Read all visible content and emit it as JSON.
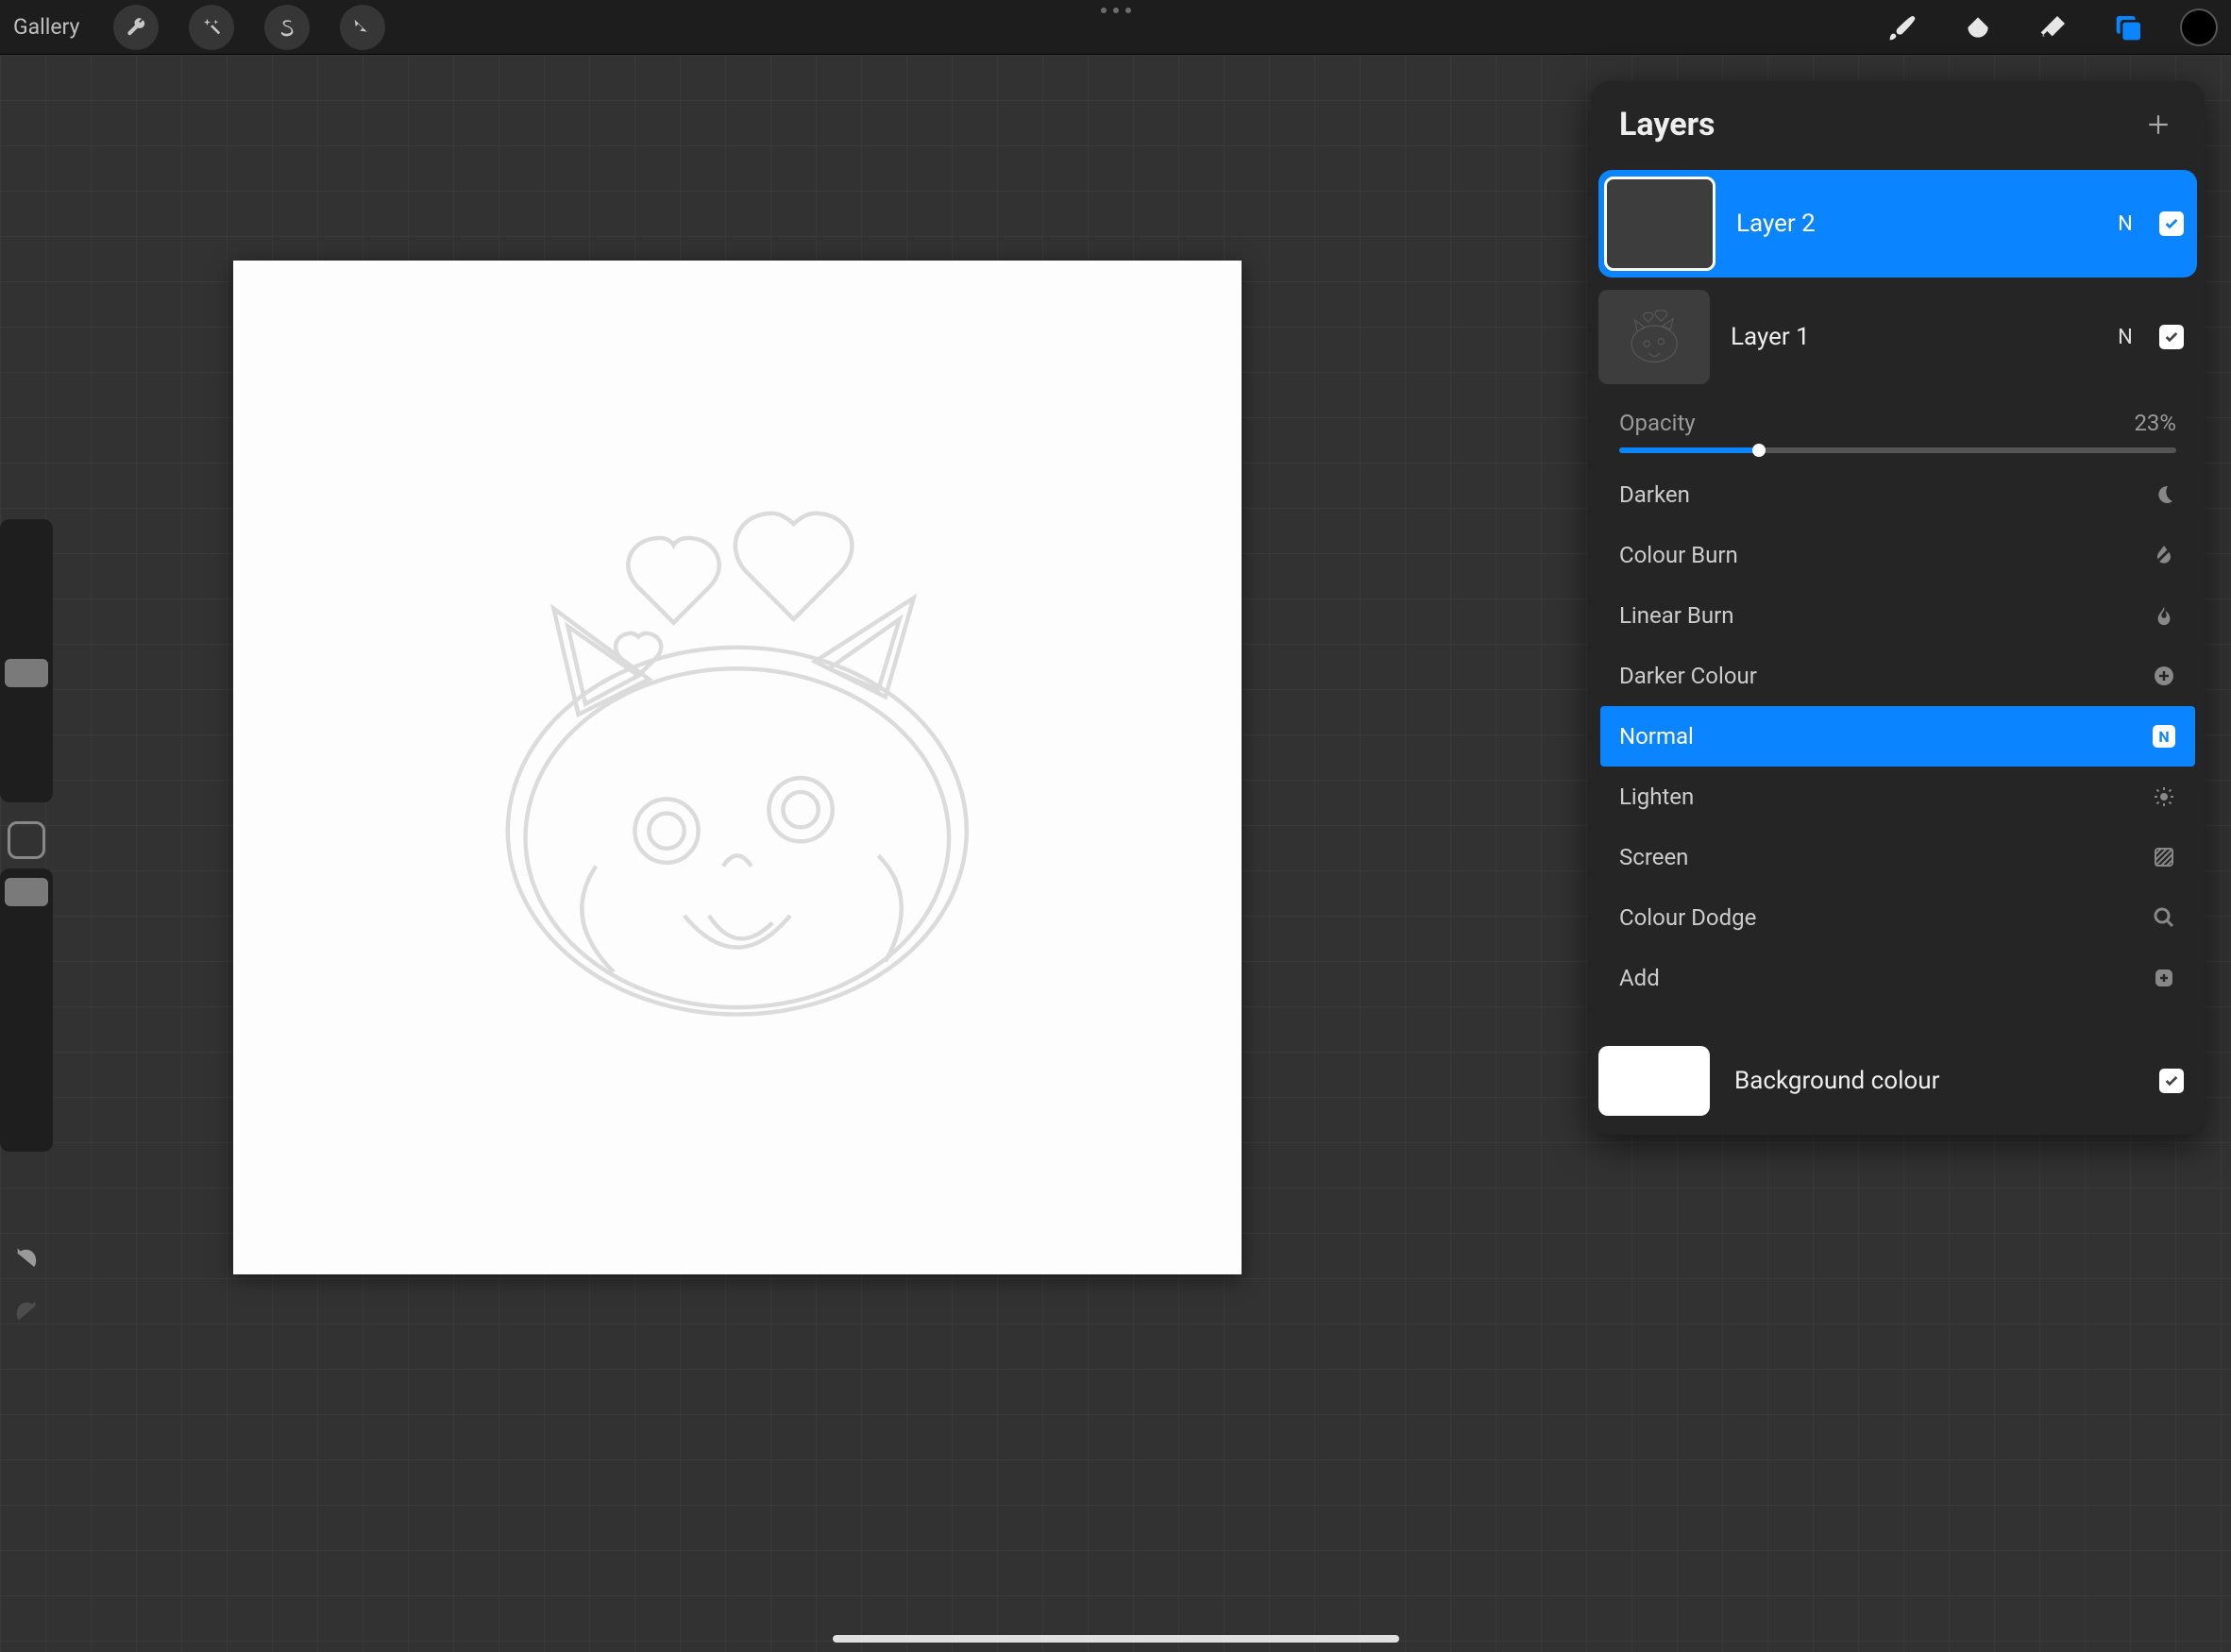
{
  "topbar": {
    "gallery_label": "Gallery"
  },
  "layers_panel": {
    "title": "Layers",
    "opacity_label": "Opacity",
    "opacity_value": "23%",
    "opacity_percent": 23,
    "layers": [
      {
        "name": "Layer 2",
        "mode_abbr": "N",
        "visible": true,
        "selected": true
      },
      {
        "name": "Layer 1",
        "mode_abbr": "N",
        "visible": true,
        "selected": false
      }
    ],
    "blend_modes": [
      {
        "label": "Darken",
        "icon": "moon",
        "selected": false
      },
      {
        "label": "Colour Burn",
        "icon": "drop-off",
        "selected": false
      },
      {
        "label": "Linear Burn",
        "icon": "flame",
        "selected": false
      },
      {
        "label": "Darker Colour",
        "icon": "plus-circ",
        "selected": false
      },
      {
        "label": "Normal",
        "icon": "badge-n",
        "selected": true
      },
      {
        "label": "Lighten",
        "icon": "sun",
        "selected": false
      },
      {
        "label": "Screen",
        "icon": "hatch",
        "selected": false
      },
      {
        "label": "Colour Dodge",
        "icon": "magnify",
        "selected": false
      },
      {
        "label": "Add",
        "icon": "plus-sq",
        "selected": false
      }
    ],
    "background_label": "Background colour"
  }
}
